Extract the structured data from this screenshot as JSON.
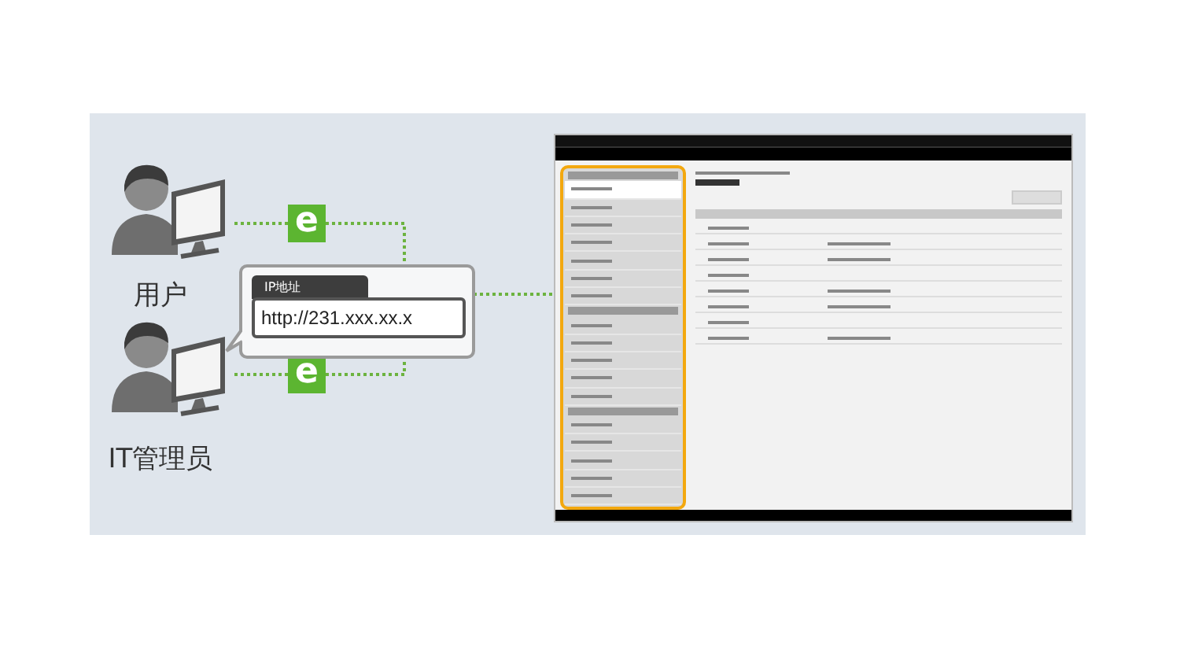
{
  "people": [
    {
      "label": "用户"
    },
    {
      "label": "IT管理员"
    }
  ],
  "badges": [
    {
      "text": "e"
    },
    {
      "text": "e"
    }
  ],
  "address_bubble": {
    "tab": "IP地址",
    "url": "http://231.xxx.xx.x"
  }
}
